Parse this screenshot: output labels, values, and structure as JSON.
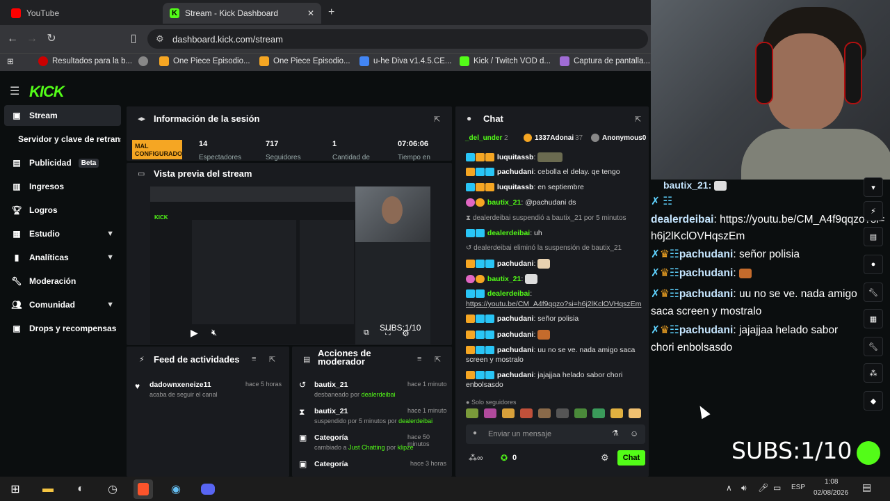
{
  "browser": {
    "tabs": [
      {
        "label": "YouTube"
      },
      {
        "label": "Stream - Kick Dashboard"
      }
    ],
    "url": "dashboard.kick.com/stream",
    "bookmarks": [
      "Resultados para la b...",
      "One Piece Episodio...",
      "One Piece Episodio...",
      "u-he Diva v1.4.5.CE...",
      "Kick / Twitch VOD d...",
      "Captura de pantalla..."
    ]
  },
  "sidebar": {
    "items": [
      {
        "label": "Stream",
        "icon": "video-icon"
      },
      {
        "label": "Servidor y clave de retransmisión",
        "icon": ""
      },
      {
        "label": "Publicidad",
        "icon": "megaphone-icon",
        "badge": "Beta"
      },
      {
        "label": "Ingresos",
        "icon": "chart-icon"
      },
      {
        "label": "Logros",
        "icon": "trophy-icon"
      },
      {
        "label": "Estudio",
        "icon": "studio-icon"
      },
      {
        "label": "Analíticas",
        "icon": "analytics-icon"
      },
      {
        "label": "Moderación",
        "icon": "wrench-icon"
      },
      {
        "label": "Comunidad",
        "icon": "people-icon"
      },
      {
        "label": "Drops y recompensas",
        "icon": "gift-icon"
      }
    ]
  },
  "session": {
    "title": "Información de la sesión",
    "status": "MAL CONFIGURADO",
    "stats": [
      {
        "value": "14",
        "label": "Espectadores"
      },
      {
        "value": "717",
        "label": "Seguidores"
      },
      {
        "value": "1",
        "label": "Cantidad de"
      },
      {
        "value": "07:06:06",
        "label": "Tiempo en"
      }
    ]
  },
  "preview": {
    "title": "Vista previa del stream",
    "subs": "SUBS:1/10"
  },
  "feed": {
    "title": "Feed de actividades",
    "items": [
      {
        "user": "dadownxeneize11",
        "text": "acaba de seguir el canal",
        "time": "hace 5 horas"
      }
    ]
  },
  "modactions": {
    "title": "Acciones de moderador",
    "items": [
      {
        "target": "bautix_21",
        "pre": "desbaneado por ",
        "mod": "dealerdeibai",
        "post": "",
        "time": "hace 1 minuto"
      },
      {
        "target": "bautix_21",
        "pre": "suspendido por 5 minutos por ",
        "mod": "dealerdeibai",
        "post": "",
        "time": "hace 1 minuto"
      },
      {
        "target": "Categoría",
        "pre": "cambiado a ",
        "mod": "Just Chatting",
        "post": " por ",
        "mod2": "klipze",
        "time": "hace 50 minutos"
      },
      {
        "target": "Categoría",
        "pre": "",
        "mod": "",
        "post": "",
        "time": "hace 3 horas"
      }
    ]
  },
  "chat": {
    "title": "Chat",
    "leaderboard": [
      {
        "name": "_del_under",
        "n": "2"
      },
      {
        "name": "1337Adonai",
        "n": "37"
      },
      {
        "name": "Anonymous0",
        "n": ""
      }
    ],
    "messages": [
      {
        "user": "luquitassb",
        "text": ""
      },
      {
        "user": "pachudani",
        "text": "cebolla el delay. qe tengo"
      },
      {
        "user": "luquitassb",
        "text": "en septiembre"
      },
      {
        "user": "bautix_21",
        "text": "@pachudani ds"
      },
      {
        "sys": "dealerdeibai suspendió a bautix_21 por 5 minutos"
      },
      {
        "user": "dealerdeibai",
        "text": "uh"
      },
      {
        "sys": "dealerdeibai eliminó la suspensión de bautix_21"
      },
      {
        "user": "pachudani",
        "text": ""
      },
      {
        "user": "bautix_21",
        "text": ""
      },
      {
        "user": "dealerdeibai",
        "text": "https://youtu.be/CM_A4f9qqzo?si=h6j2lKclOVHqszEm"
      },
      {
        "user": "pachudani",
        "text": "señor polisia"
      },
      {
        "user": "pachudani",
        "text": ""
      },
      {
        "user": "pachudani",
        "text": "uu no se ve. nada amigo saca screen y mostralo"
      },
      {
        "user": "pachudani",
        "text": "jajajjaa helado sabor chori enbolsasdo"
      }
    ],
    "mode": "Solo seguidores",
    "input_placeholder": "Enviar un mensaje",
    "points": "0",
    "send_label": "Chat"
  },
  "overlay": {
    "top_user": "bautix_21",
    "messages": [
      {
        "user": "dealerdeibai",
        "text": "https://youtu.be/CM_A4f9qqzo?si=h6j2lKclOVHqszEm"
      },
      {
        "user": "pachudani",
        "text": "señor polisia"
      },
      {
        "user": "pachudani",
        "text": ""
      },
      {
        "user": "pachudani",
        "text": "uu no se ve. nada amigo saca screen y mostralo"
      },
      {
        "user": "pachudani",
        "text": "jajajjaa helado sabor chori enbolsasdo"
      }
    ],
    "subs": "SUBS:1/10"
  },
  "taskbar": {
    "lang": "ESP",
    "time": "1:08",
    "date": "02/08/2026"
  }
}
